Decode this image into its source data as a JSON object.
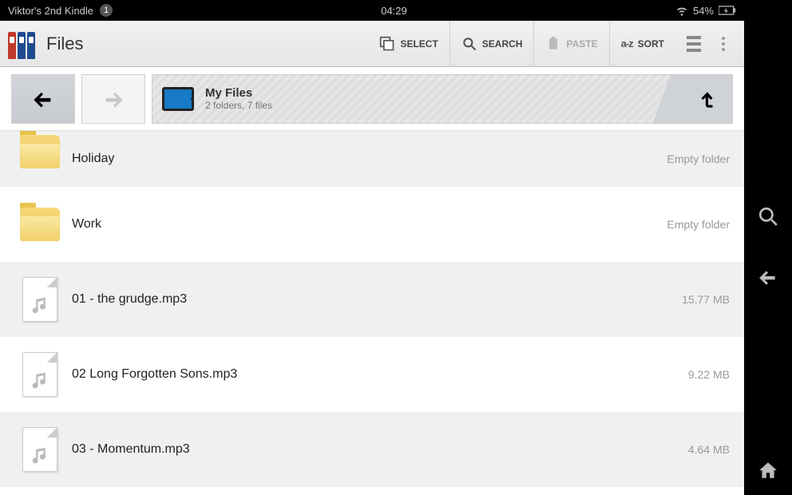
{
  "status": {
    "device": "Viktor's 2nd Kindle",
    "notif_count": "1",
    "time": "04:29",
    "battery": "54%"
  },
  "app": {
    "title": "Files"
  },
  "toolbar": {
    "select": "SELECT",
    "search": "SEARCH",
    "paste": "PASTE",
    "sort": "SORT"
  },
  "breadcrumb": {
    "title": "My Files",
    "subtitle": "2 folders, 7 files"
  },
  "rows": [
    {
      "name": "Holiday",
      "meta": "Empty folder",
      "kind": "folder"
    },
    {
      "name": "Work",
      "meta": "Empty folder",
      "kind": "folder"
    },
    {
      "name": "01 - the grudge.mp3",
      "meta": "15.77 MB",
      "kind": "audio"
    },
    {
      "name": "02 Long Forgotten Sons.mp3",
      "meta": "9.22 MB",
      "kind": "audio"
    },
    {
      "name": "03 - Momentum.mp3",
      "meta": "4.64 MB",
      "kind": "audio"
    }
  ]
}
